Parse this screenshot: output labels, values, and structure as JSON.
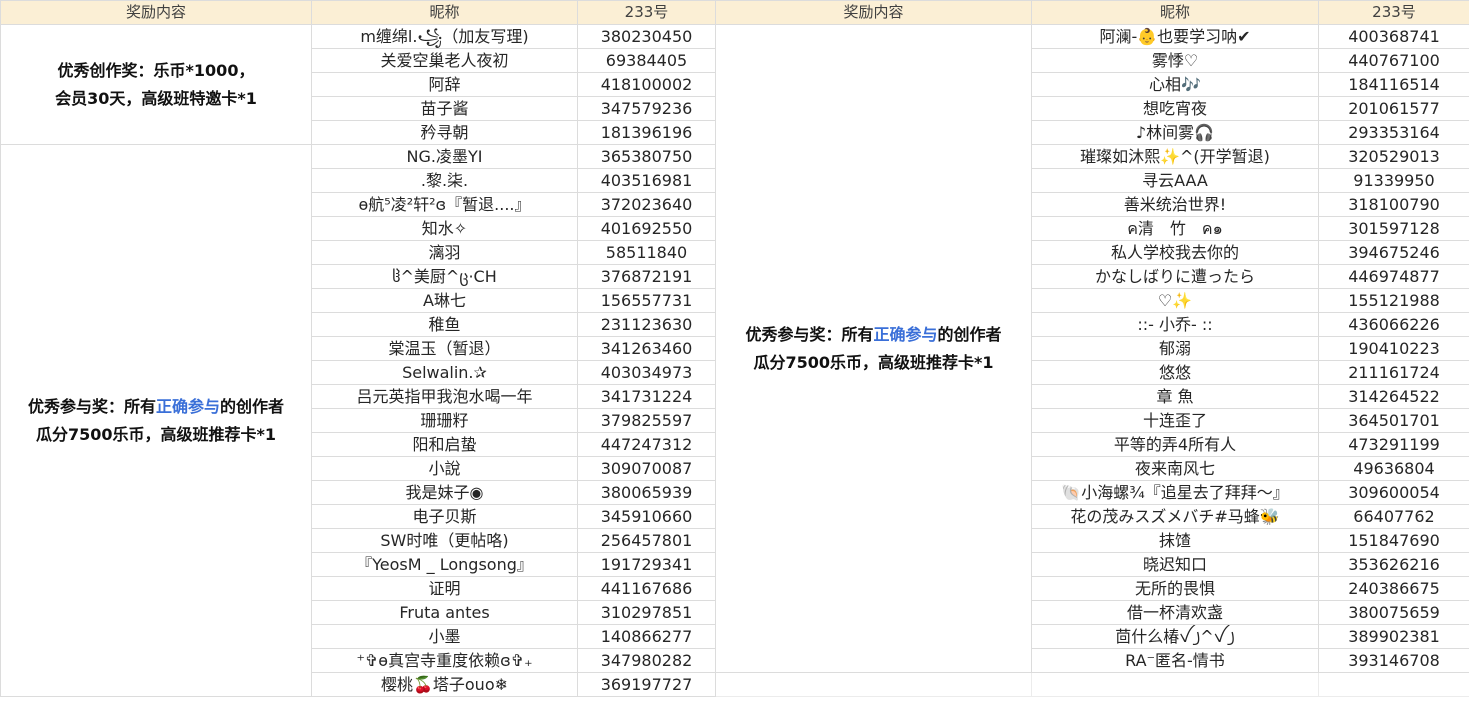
{
  "headers": {
    "reward": "奖励内容",
    "nick": "昵称",
    "id": "233号"
  },
  "left_rewards": [
    {
      "lines": [
        "优秀创作奖：乐币*1000，",
        "会员30天，高级班特邀卡*1"
      ]
    },
    {
      "line1_a": "优秀参与奖：所有",
      "line1_hl": "正确参与",
      "line1_b": "的创作者",
      "line2": "瓜分7500乐币，高级班推荐卡*1"
    }
  ],
  "right_reward": {
    "line1_a": "优秀参与奖：所有",
    "line1_hl": "正确参与",
    "line1_b": "的创作者",
    "line2": "瓜分7500乐币，高级班推荐卡*1"
  },
  "left_rows": [
    {
      "nick": "m缠绵l.꧁（加友写理)",
      "id": "380230450"
    },
    {
      "nick": "关爱空巢老人夜初",
      "id": "69384405"
    },
    {
      "nick": "阿辞",
      "id": "418100002"
    },
    {
      "nick": "苗子酱",
      "id": "347579236"
    },
    {
      "nick": "矜寻朝",
      "id": "181396196"
    },
    {
      "nick": "NG.凌墨YI",
      "id": "365380750"
    },
    {
      "nick": ".黎.柒.",
      "id": "403516981"
    },
    {
      "nick": "ɵ航⁵凌²轩²ɞ『暂退....』",
      "id": "372023640"
    },
    {
      "nick": "知水✧",
      "id": "401692550"
    },
    {
      "nick": "漓羽",
      "id": "58511840"
    },
    {
      "nick": "ჱ^美厨^ც·CH",
      "id": "376872191"
    },
    {
      "nick": "A琳七",
      "id": "156557731"
    },
    {
      "nick": "稚鱼",
      "id": "231123630"
    },
    {
      "nick": "棠温玉（暂退）",
      "id": "341263460"
    },
    {
      "nick": "Selwalin.✰",
      "id": "403034973"
    },
    {
      "nick": "吕元英指甲我泡水喝一年",
      "id": "341731224"
    },
    {
      "nick": "珊珊籽",
      "id": "379825597"
    },
    {
      "nick": "阳和启蛰",
      "id": "447247312"
    },
    {
      "nick": "小說",
      "id": "309070087"
    },
    {
      "nick": "我是妹子◉",
      "id": "380065939"
    },
    {
      "nick": "电子贝斯",
      "id": "345910660"
    },
    {
      "nick": "SW时唯（更帖咯)",
      "id": "256457801"
    },
    {
      "nick": "『YeosM _ Longsong』",
      "id": "191729341"
    },
    {
      "nick": "证明",
      "id": "441167686"
    },
    {
      "nick": "Fruta antes",
      "id": "310297851"
    },
    {
      "nick": "小墨",
      "id": "140866277"
    },
    {
      "nick": "⁺✞ɵ真宫寺重度依赖ɞ✞₊",
      "id": "347980282"
    },
    {
      "nick": "樱桃🍒塔子ouo❄",
      "id": "369197727"
    }
  ],
  "right_rows": [
    {
      "nick": "阿澜-👶也要学习呐✔",
      "id": "400368741"
    },
    {
      "nick": "雾悸♡",
      "id": "440767100"
    },
    {
      "nick": "心相🎶",
      "id": "184116514"
    },
    {
      "nick": "想吃宵夜",
      "id": "201061577"
    },
    {
      "nick": "♪林间雾🎧",
      "id": "293353164"
    },
    {
      "nick": "璀璨如沐熙✨^(开学暂退)",
      "id": "320529013"
    },
    {
      "nick": "寻云AAA",
      "id": "91339950"
    },
    {
      "nick": "善米统治世界!",
      "id": "318100790"
    },
    {
      "nick": "ค清　竹　ค๑",
      "id": "301597128"
    },
    {
      "nick": "私人学校我去你的",
      "id": "394675246"
    },
    {
      "nick": "かなしばりに遭ったら",
      "id": "446974877"
    },
    {
      "nick": "♡✨",
      "id": "155121988"
    },
    {
      "nick": "::- 小乔- ::",
      "id": "436066226"
    },
    {
      "nick": "郁溺",
      "id": "190410223"
    },
    {
      "nick": "悠悠",
      "id": "211161724"
    },
    {
      "nick": "章 魚",
      "id": "314264522"
    },
    {
      "nick": "十连歪了",
      "id": "364501701"
    },
    {
      "nick": "平等的弄4所有人",
      "id": "473291199"
    },
    {
      "nick": "夜来南风七",
      "id": "49636804"
    },
    {
      "nick": "🐚小海螺¾『追星去了拜拜～』",
      "id": "309600054"
    },
    {
      "nick": "花の茂みスズメバチ#马蜂🐝",
      "id": "66407762"
    },
    {
      "nick": "抹馇",
      "id": "151847690"
    },
    {
      "nick": "晓迟知口",
      "id": "353626216"
    },
    {
      "nick": "无所的畏惧",
      "id": "240386675"
    },
    {
      "nick": "借一杯清欢盏",
      "id": "380075659"
    },
    {
      "nick": "茴什么椿ꪜ ꠸^ꪜ ꠸",
      "id": "389902381"
    },
    {
      "nick": "RA⁻匿名-情书",
      "id": "393146708"
    }
  ]
}
